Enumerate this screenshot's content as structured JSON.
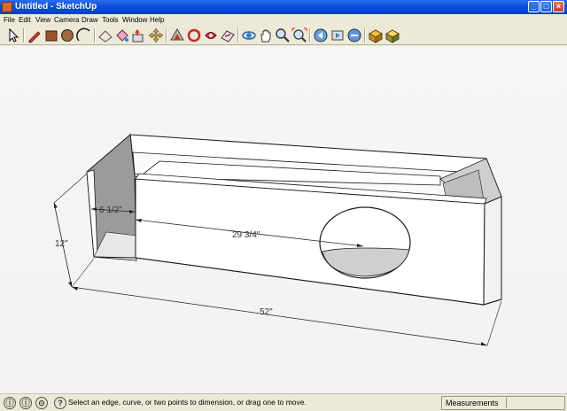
{
  "window": {
    "title": "Untitled - SketchUp"
  },
  "menu": [
    "File",
    "Edit",
    "View",
    "Camera",
    "Draw",
    "Tools",
    "Window",
    "Help"
  ],
  "toolbar": {
    "tools": [
      "select-icon",
      "pencil-line-icon",
      "rectangle-icon",
      "circle-icon",
      "arc-icon",
      "eraser-icon",
      "paint-bucket-icon",
      "push-pull-icon",
      "move-icon",
      "rotate-icon",
      "follow-me-icon",
      "offset-icon",
      "orbit-icon",
      "pan-icon",
      "zoom-icon",
      "zoom-extents-icon",
      "previous-view-icon",
      "next-view-icon",
      "top-view-icon",
      "components-icon",
      "materials-icon"
    ]
  },
  "dimensions": {
    "depth": "6 1/2\"",
    "inner_length": "29 3/4\"",
    "height": "12\"",
    "length": "52\""
  },
  "status": {
    "hint": "Select an edge, curve, or two points to dimension, or drag one to move.",
    "measurements_label": "Measurements",
    "measurements_value": ""
  },
  "colors": {
    "titlebar": "#0a4fd6",
    "viewport": "#f4f4f4",
    "box_face": "#ffffff",
    "box_shade": "#9a9a9a"
  }
}
